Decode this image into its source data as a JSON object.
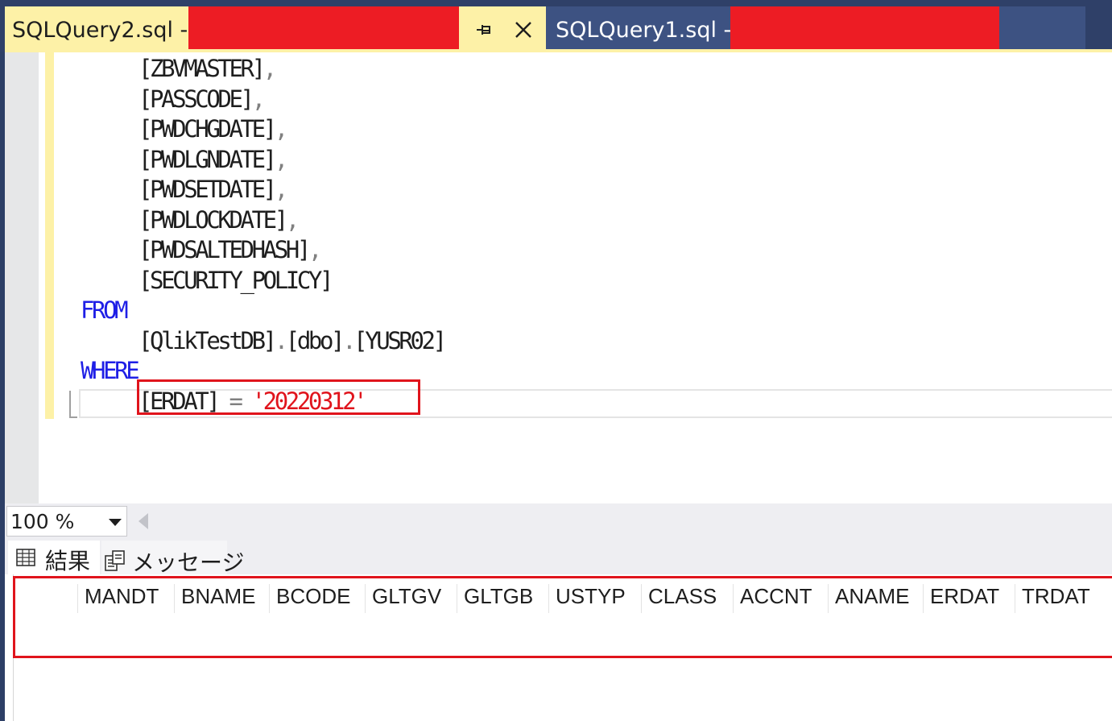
{
  "tabs": {
    "active": {
      "title": "SQLQuery2.sql -",
      "pin_icon": "pin-icon",
      "close_icon": "close-icon"
    },
    "inactive": {
      "title": "SQLQuery1.sql -"
    }
  },
  "editor": {
    "lines": [
      {
        "indent": true,
        "parts": [
          {
            "t": "[ZBVMASTER]",
            "c": "ident"
          },
          {
            "t": ",",
            "c": "punct"
          }
        ]
      },
      {
        "indent": true,
        "parts": [
          {
            "t": "[PASSCODE]",
            "c": "ident"
          },
          {
            "t": ",",
            "c": "punct"
          }
        ]
      },
      {
        "indent": true,
        "parts": [
          {
            "t": "[PWDCHGDATE]",
            "c": "ident"
          },
          {
            "t": ",",
            "c": "punct"
          }
        ]
      },
      {
        "indent": true,
        "parts": [
          {
            "t": "[PWDLGNDATE]",
            "c": "ident"
          },
          {
            "t": ",",
            "c": "punct"
          }
        ]
      },
      {
        "indent": true,
        "parts": [
          {
            "t": "[PWDSETDATE]",
            "c": "ident"
          },
          {
            "t": ",",
            "c": "punct"
          }
        ]
      },
      {
        "indent": true,
        "parts": [
          {
            "t": "[PWDLOCKDATE]",
            "c": "ident"
          },
          {
            "t": ",",
            "c": "punct"
          }
        ]
      },
      {
        "indent": true,
        "parts": [
          {
            "t": "[PWDSALTEDHASH]",
            "c": "ident"
          },
          {
            "t": ",",
            "c": "punct"
          }
        ]
      },
      {
        "indent": true,
        "parts": [
          {
            "t": "[SECURITY_POLICY]",
            "c": "ident"
          }
        ]
      },
      {
        "indent": false,
        "parts": [
          {
            "t": "FROM",
            "c": "kw"
          }
        ]
      },
      {
        "indent": true,
        "parts": [
          {
            "t": "[QlikTestDB]",
            "c": "ident"
          },
          {
            "t": ".",
            "c": "punct"
          },
          {
            "t": "[dbo]",
            "c": "ident"
          },
          {
            "t": ".",
            "c": "punct"
          },
          {
            "t": "[YUSR02]",
            "c": "ident"
          }
        ]
      },
      {
        "indent": false,
        "parts": [
          {
            "t": "WHERE",
            "c": "kw"
          }
        ]
      },
      {
        "indent": true,
        "parts": [
          {
            "t": "[ERDAT]",
            "c": "ident"
          },
          {
            "t": " = ",
            "c": "punct"
          },
          {
            "t": "'20220312'",
            "c": "str"
          }
        ]
      }
    ]
  },
  "zoom": {
    "value": "100 %"
  },
  "results_tabs": [
    {
      "label": "結果",
      "icon": "grid-icon"
    },
    {
      "label": "メッセージ",
      "icon": "messages-icon"
    }
  ],
  "results_grid": {
    "columns": [
      "MANDT",
      "BNAME",
      "BCODE",
      "GLTGV",
      "GLTGB",
      "USTYP",
      "CLASS",
      "ACCNT",
      "ANAME",
      "ERDAT",
      "TRDAT"
    ],
    "rows": []
  },
  "colors": {
    "tab_active": "#fdf1a7",
    "tab_strip": "#2f4068",
    "keyword": "#1f1fe6",
    "string": "#e0141c",
    "highlight_box": "#e0141c",
    "redaction": "#ed1c24"
  }
}
